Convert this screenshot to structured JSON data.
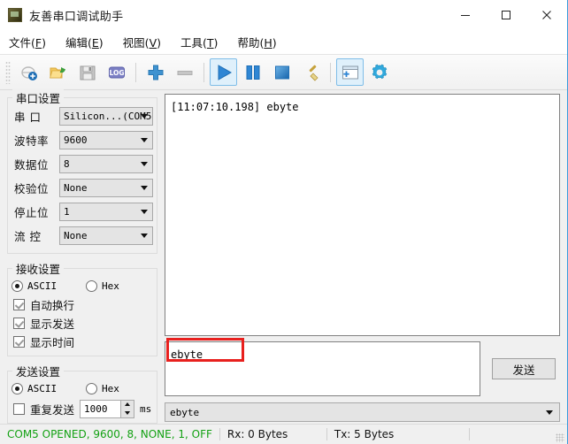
{
  "window": {
    "title": "友善串口调试助手",
    "icon": "app-icon",
    "minimize_label": "–",
    "maximize_label": "□",
    "close_label": "✕"
  },
  "menu": {
    "items": [
      {
        "label": "文件(F)",
        "text": "文件(",
        "key": "F",
        "tail": ")"
      },
      {
        "label": "编辑(E)",
        "text": "编辑(",
        "key": "E",
        "tail": ")"
      },
      {
        "label": "视图(V)",
        "text": "视图(",
        "key": "V",
        "tail": ")"
      },
      {
        "label": "工具(T)",
        "text": "工具(",
        "key": "T",
        "tail": ")"
      },
      {
        "label": "帮助(H)",
        "text": "帮助(",
        "key": "H",
        "tail": ")"
      }
    ]
  },
  "toolbar": {
    "buttons": [
      {
        "name": "open-port-icon",
        "active": false
      },
      {
        "name": "open-file-icon",
        "active": false
      },
      {
        "name": "save-icon",
        "active": false
      },
      {
        "name": "log-icon",
        "active": false,
        "text": "LOG"
      },
      {
        "name": "add-icon",
        "active": false
      },
      {
        "name": "remove-icon",
        "active": false
      },
      {
        "name": "play-icon",
        "active": true
      },
      {
        "name": "pause-icon",
        "active": false
      },
      {
        "name": "stop-icon",
        "active": false
      },
      {
        "name": "clear-broom-icon",
        "active": false
      },
      {
        "name": "new-window-icon",
        "active": true
      },
      {
        "name": "settings-gear-icon",
        "active": false
      }
    ]
  },
  "serial_settings": {
    "title": "串口设置",
    "fields": [
      {
        "label": "串  口",
        "value": "Silicon...(COM5"
      },
      {
        "label": "波特率",
        "value": "9600"
      },
      {
        "label": "数据位",
        "value": "8"
      },
      {
        "label": "校验位",
        "value": "None"
      },
      {
        "label": "停止位",
        "value": "1"
      },
      {
        "label": "流  控",
        "value": "None"
      }
    ]
  },
  "receive_settings": {
    "title": "接收设置",
    "mode_ascii": "ASCII",
    "mode_hex": "Hex",
    "mode_selected": "ASCII",
    "checkboxes": [
      {
        "label": "自动换行",
        "checked": true
      },
      {
        "label": "显示发送",
        "checked": true
      },
      {
        "label": "显示时间",
        "checked": true
      }
    ]
  },
  "send_settings": {
    "title": "发送设置",
    "mode_ascii": "ASCII",
    "mode_hex": "Hex",
    "mode_selected": "ASCII",
    "repeat_label": "重复发送",
    "repeat_checked": false,
    "repeat_interval": "1000",
    "unit": "ms"
  },
  "terminal": {
    "lines": [
      "[11:07:10.198] ebyte"
    ]
  },
  "send_area": {
    "value": "ebyte",
    "send_button": "发送",
    "highlight_color": "#e8201e"
  },
  "history": {
    "value": "ebyte"
  },
  "statusbar": {
    "connection": "COM5 OPENED, 9600, 8, NONE, 1, OFF",
    "connection_color": "#13a113",
    "rx": "Rx: 0 Bytes",
    "tx": "Tx: 5 Bytes"
  }
}
